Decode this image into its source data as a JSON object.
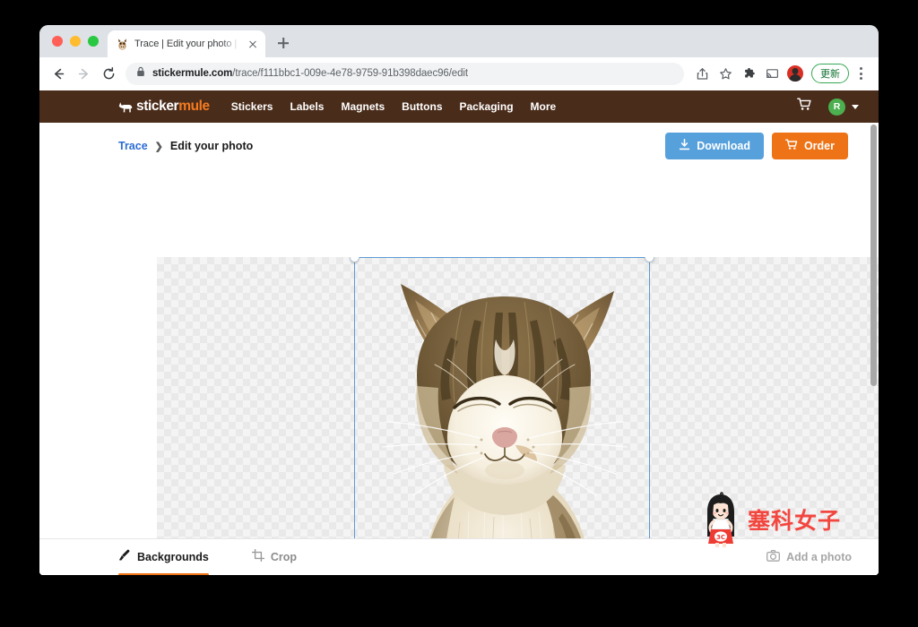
{
  "browser": {
    "tab": {
      "title": "Trace | Edit your photo | Sticke",
      "favicon_name": "mule-favicon"
    },
    "new_tab_label": "+",
    "toolbar": {
      "back_icon": "back-arrow-icon",
      "forward_icon": "forward-arrow-icon",
      "reload_icon": "reload-icon",
      "lock_icon": "lock-icon",
      "url_domain": "stickermule.com",
      "url_path": "/trace/f111bbc1-009e-4e78-9759-91b398daec96/edit",
      "share_icon": "share-icon",
      "bookmark_icon": "star-icon",
      "extensions_icon": "puzzle-piece-icon",
      "cast_icon": "cast-icon",
      "profile_icon": "profile-avatar-icon",
      "update_label": "更新",
      "menu_icon": "kebab-menu-icon"
    },
    "window_controls": [
      "close",
      "minimize",
      "maximize"
    ]
  },
  "site": {
    "brand": {
      "word_white": "sticker",
      "word_orange": "mule",
      "logo_icon": "mule-logo-icon",
      "color_orange": "#f47b20",
      "header_bg": "#4a2c1a"
    },
    "nav_items": [
      {
        "label": "Stickers"
      },
      {
        "label": "Labels"
      },
      {
        "label": "Magnets"
      },
      {
        "label": "Buttons"
      },
      {
        "label": "Packaging"
      },
      {
        "label": "More"
      }
    ],
    "cart_icon": "shopping-cart-icon",
    "user_avatar_initial": "R",
    "avatar_color": "#4caf50"
  },
  "page": {
    "breadcrumb": {
      "parent": "Trace",
      "separator": "›",
      "current": "Edit your photo"
    },
    "actions": {
      "download_label": "Download",
      "download_icon": "download-icon",
      "download_color": "#56a0dc",
      "order_label": "Order",
      "order_icon": "cart-icon",
      "order_color": "#ee7316"
    },
    "canvas": {
      "transparency_pattern": "checkerboard",
      "selection_active": true,
      "image_subject": "tabby cat with closed eyes, cut out on transparent background"
    },
    "tools": [
      {
        "label": "Backgrounds",
        "icon": "brush-icon",
        "active": true
      },
      {
        "label": "Crop",
        "icon": "crop-icon",
        "active": false
      }
    ],
    "add_photo": {
      "label": "Add a photo",
      "icon": "camera-icon"
    },
    "active_tab_underline_color": "#ee7316"
  },
  "watermark": {
    "text": "塞科女子",
    "color": "#f2473f",
    "badge_text": "3C",
    "character_icon": "girl-mascot-icon"
  }
}
